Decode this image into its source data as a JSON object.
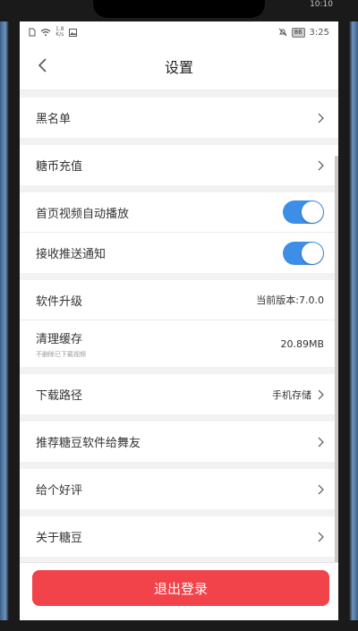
{
  "device": {
    "top_time": "10:10"
  },
  "statusbar": {
    "net_speed_value": "1.8",
    "net_speed_unit": "K/s",
    "battery": "86",
    "time": "3:25"
  },
  "navbar": {
    "title": "设置"
  },
  "settings": {
    "blacklist": "黑名单",
    "recharge": "糖币充值",
    "autoplay": "首页视频自动播放",
    "autoplay_on": true,
    "push": "接收推送通知",
    "push_on": true,
    "upgrade": "软件升级",
    "version": "当前版本:7.0.0",
    "clear_cache": "清理缓存",
    "clear_cache_sub": "不删除已下载视频",
    "cache_size": "20.89MB",
    "download_path": "下载路径",
    "download_path_value": "手机存储",
    "recommend": "推荐糖豆软件给舞友",
    "rate": "给个好评",
    "about": "关于糖豆"
  },
  "logout": {
    "label": "退出登录"
  },
  "colors": {
    "toggle_on": "#3d8ee6",
    "logout_red": "#f2424a"
  }
}
